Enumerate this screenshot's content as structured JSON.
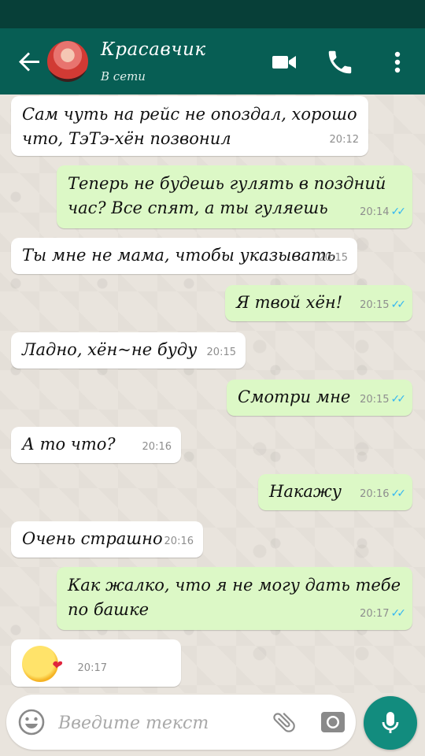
{
  "header": {
    "contact_name": "Красавчик",
    "status": "В сети"
  },
  "messages": [
    {
      "dir": "in",
      "text": "Сам чуть на рейс не опоздал, хорошо что, ТэТэ-хён позвонил",
      "time": "20:12"
    },
    {
      "dir": "out",
      "text": "Теперь не будешь гулять в поздний час? Все спят, а ты гуляешь",
      "time": "20:14"
    },
    {
      "dir": "in",
      "text": "Ты мне не мама, чтобы указывать",
      "time": "20:15"
    },
    {
      "dir": "out",
      "text": "Я твой хён!",
      "time": "20:15"
    },
    {
      "dir": "in",
      "text": "Ладно, хён~не буду",
      "time": "20:15"
    },
    {
      "dir": "out",
      "text": "Смотри мне",
      "time": "20:15"
    },
    {
      "dir": "in",
      "text": "А то что?",
      "time": "20:16"
    },
    {
      "dir": "out",
      "text": "Накажу",
      "time": "20:16"
    },
    {
      "dir": "in",
      "text": "Очень страшно",
      "time": "20:16"
    },
    {
      "dir": "out",
      "text": "Как жалко, что я не могу дать тебе по башке",
      "time": "20:17"
    },
    {
      "dir": "in",
      "emoji": "kissing-face-with-heart",
      "time": "20:17"
    }
  ],
  "composer": {
    "placeholder": "Введите текст"
  },
  "colors": {
    "header": "#075e54",
    "status_bar": "#073f38",
    "outgoing_bubble": "#dcf8c6",
    "incoming_bubble": "#ffffff",
    "read_ticks": "#34b7f1",
    "mic_button": "#128c7e"
  }
}
